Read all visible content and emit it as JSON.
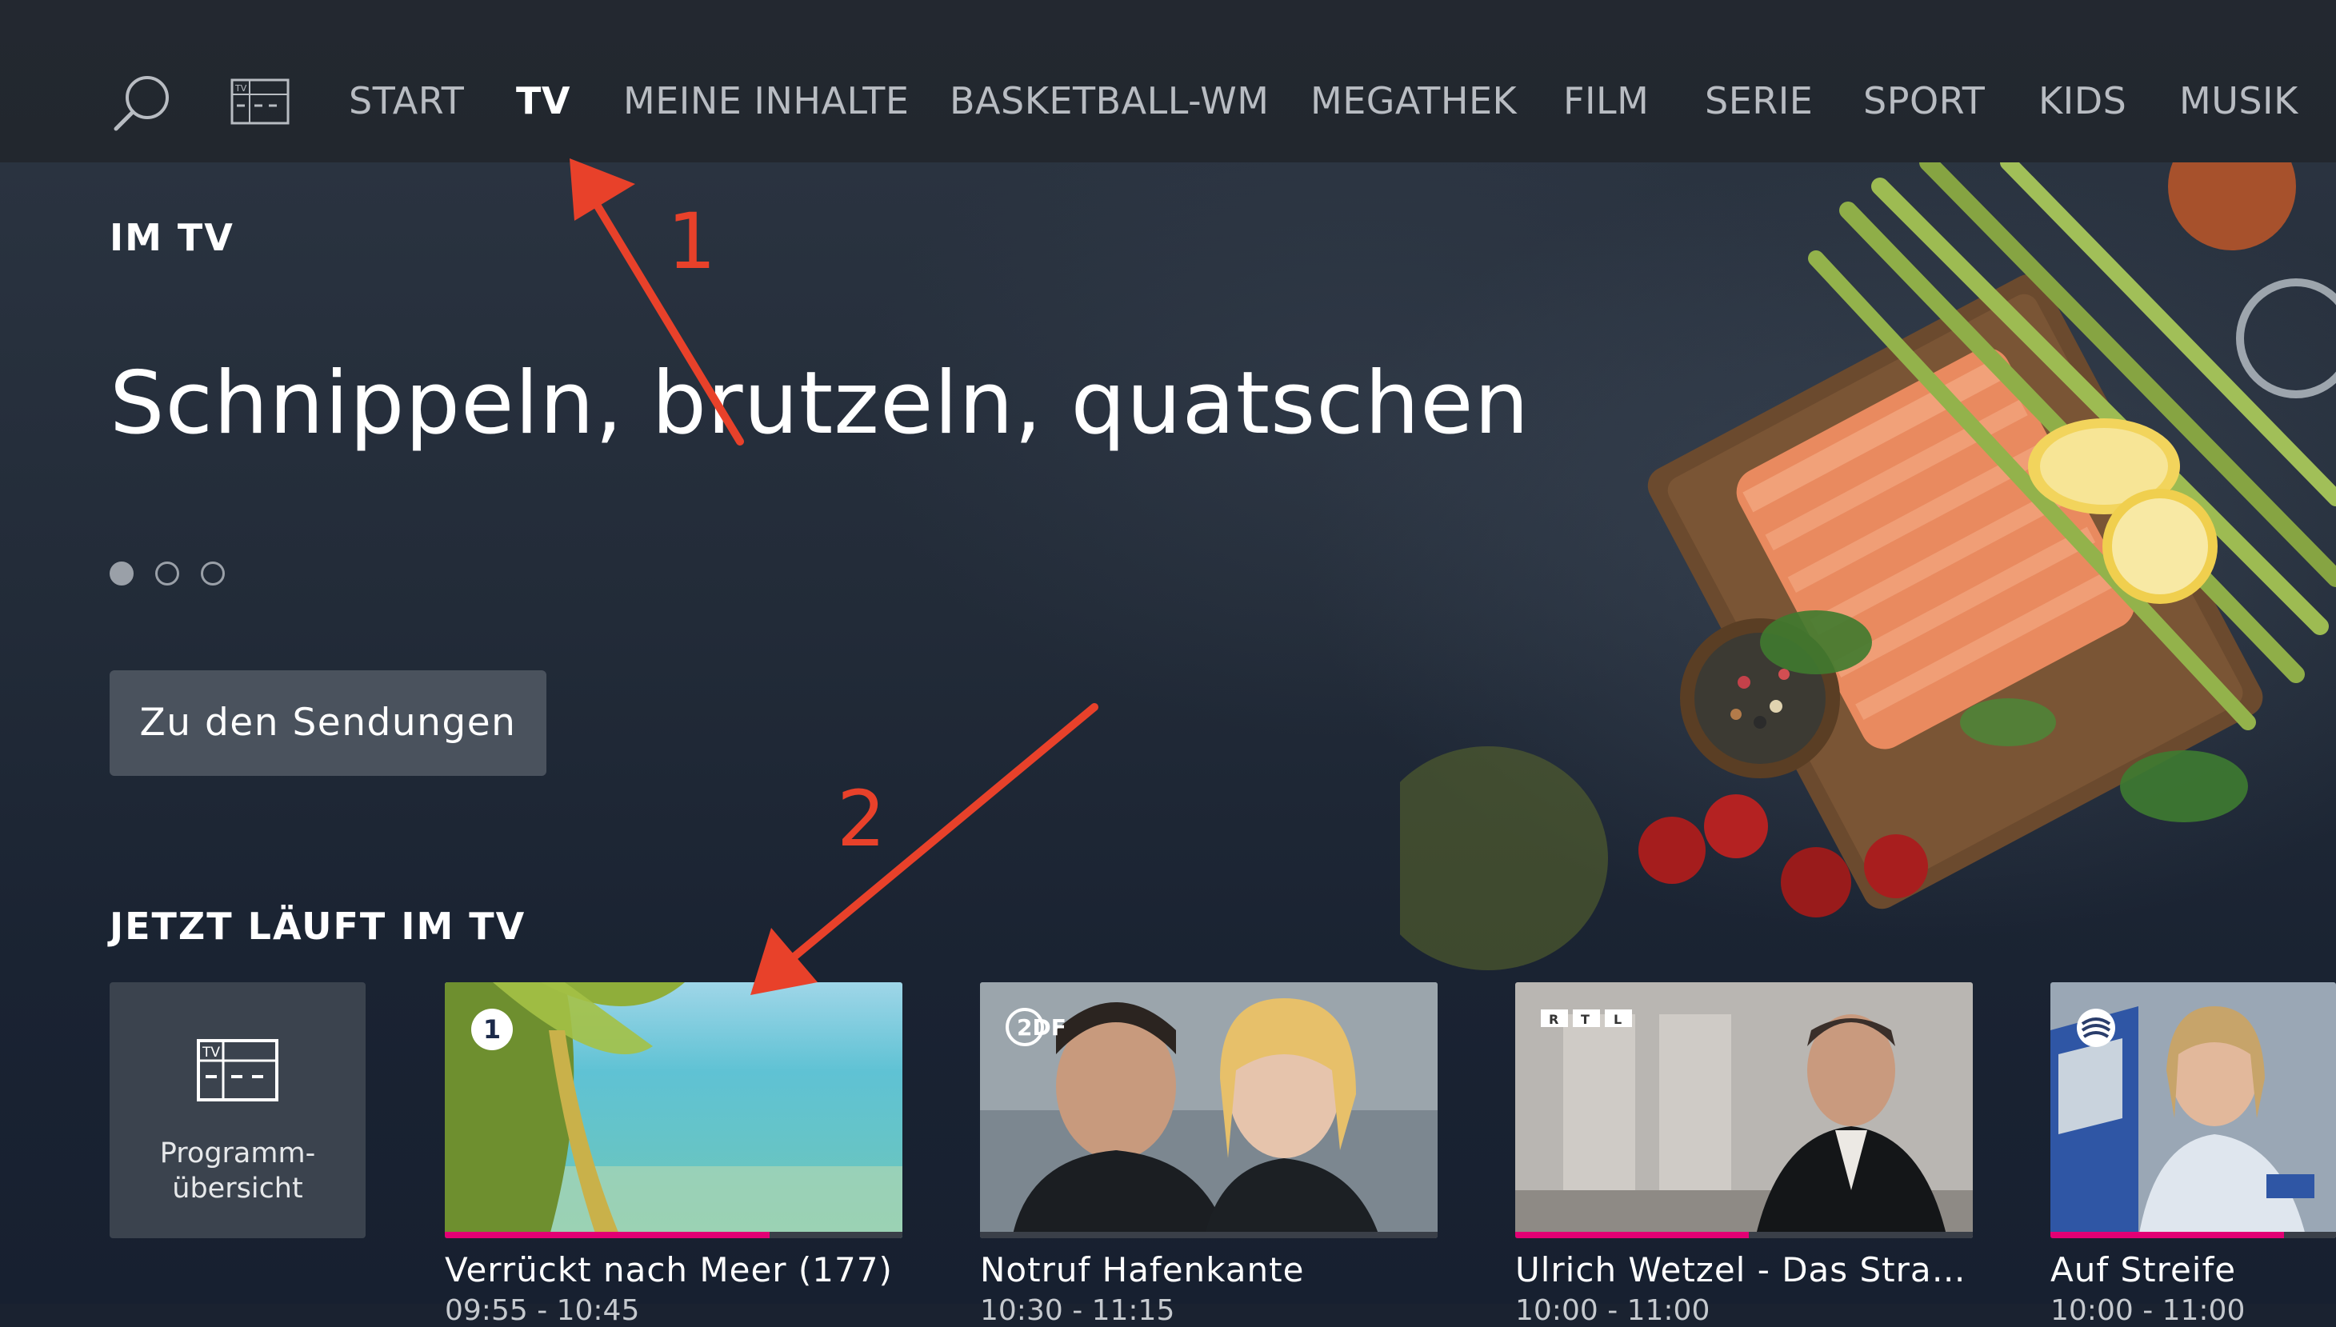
{
  "nav": {
    "items": [
      {
        "label": "START",
        "active": false
      },
      {
        "label": "TV",
        "active": true
      },
      {
        "label": "MEINE INHALTE",
        "active": false
      },
      {
        "label": "BASKETBALL-WM",
        "active": false
      },
      {
        "label": "MEGATHEK",
        "active": false
      },
      {
        "label": "FILM",
        "active": false
      },
      {
        "label": "SERIE",
        "active": false
      },
      {
        "label": "SPORT",
        "active": false
      },
      {
        "label": "KIDS",
        "active": false
      },
      {
        "label": "MUSIK",
        "active": false
      }
    ],
    "tv_guide_icon_label": "TV"
  },
  "hero": {
    "section_label": "IM TV",
    "title": "Schnippeln, brutzeln, quatschen",
    "carousel": {
      "count": 3,
      "active_index": 0
    },
    "cta_label": "Zu den Sendungen"
  },
  "live": {
    "section_label": "JETZT LÄUFT IM TV",
    "program_tile": {
      "label": "Programm-\nübersicht",
      "icon_text": "TV"
    },
    "cards": [
      {
        "title": "Verrückt nach Meer (177)",
        "subtitle": "09:55 - 10:45",
        "progress": 0.71,
        "station": "ARD"
      },
      {
        "title": "Notruf Hafenkante",
        "subtitle": "10:30 - 11:15",
        "progress": 0.0,
        "station": "ZDF"
      },
      {
        "title": "Ulrich Wetzel - Das Stra…",
        "subtitle": "10:00 - 11:00",
        "progress": 0.51,
        "station": "RTL"
      },
      {
        "title": "Auf Streife",
        "subtitle": "10:00 - 11:00",
        "progress": 0.51,
        "station": "SAT.1"
      }
    ]
  },
  "annotations": {
    "markers": [
      "1",
      "2"
    ],
    "color": "#e8412a"
  },
  "colors": {
    "accent_magenta": "#e20074",
    "button_bg": "#4a525d"
  }
}
